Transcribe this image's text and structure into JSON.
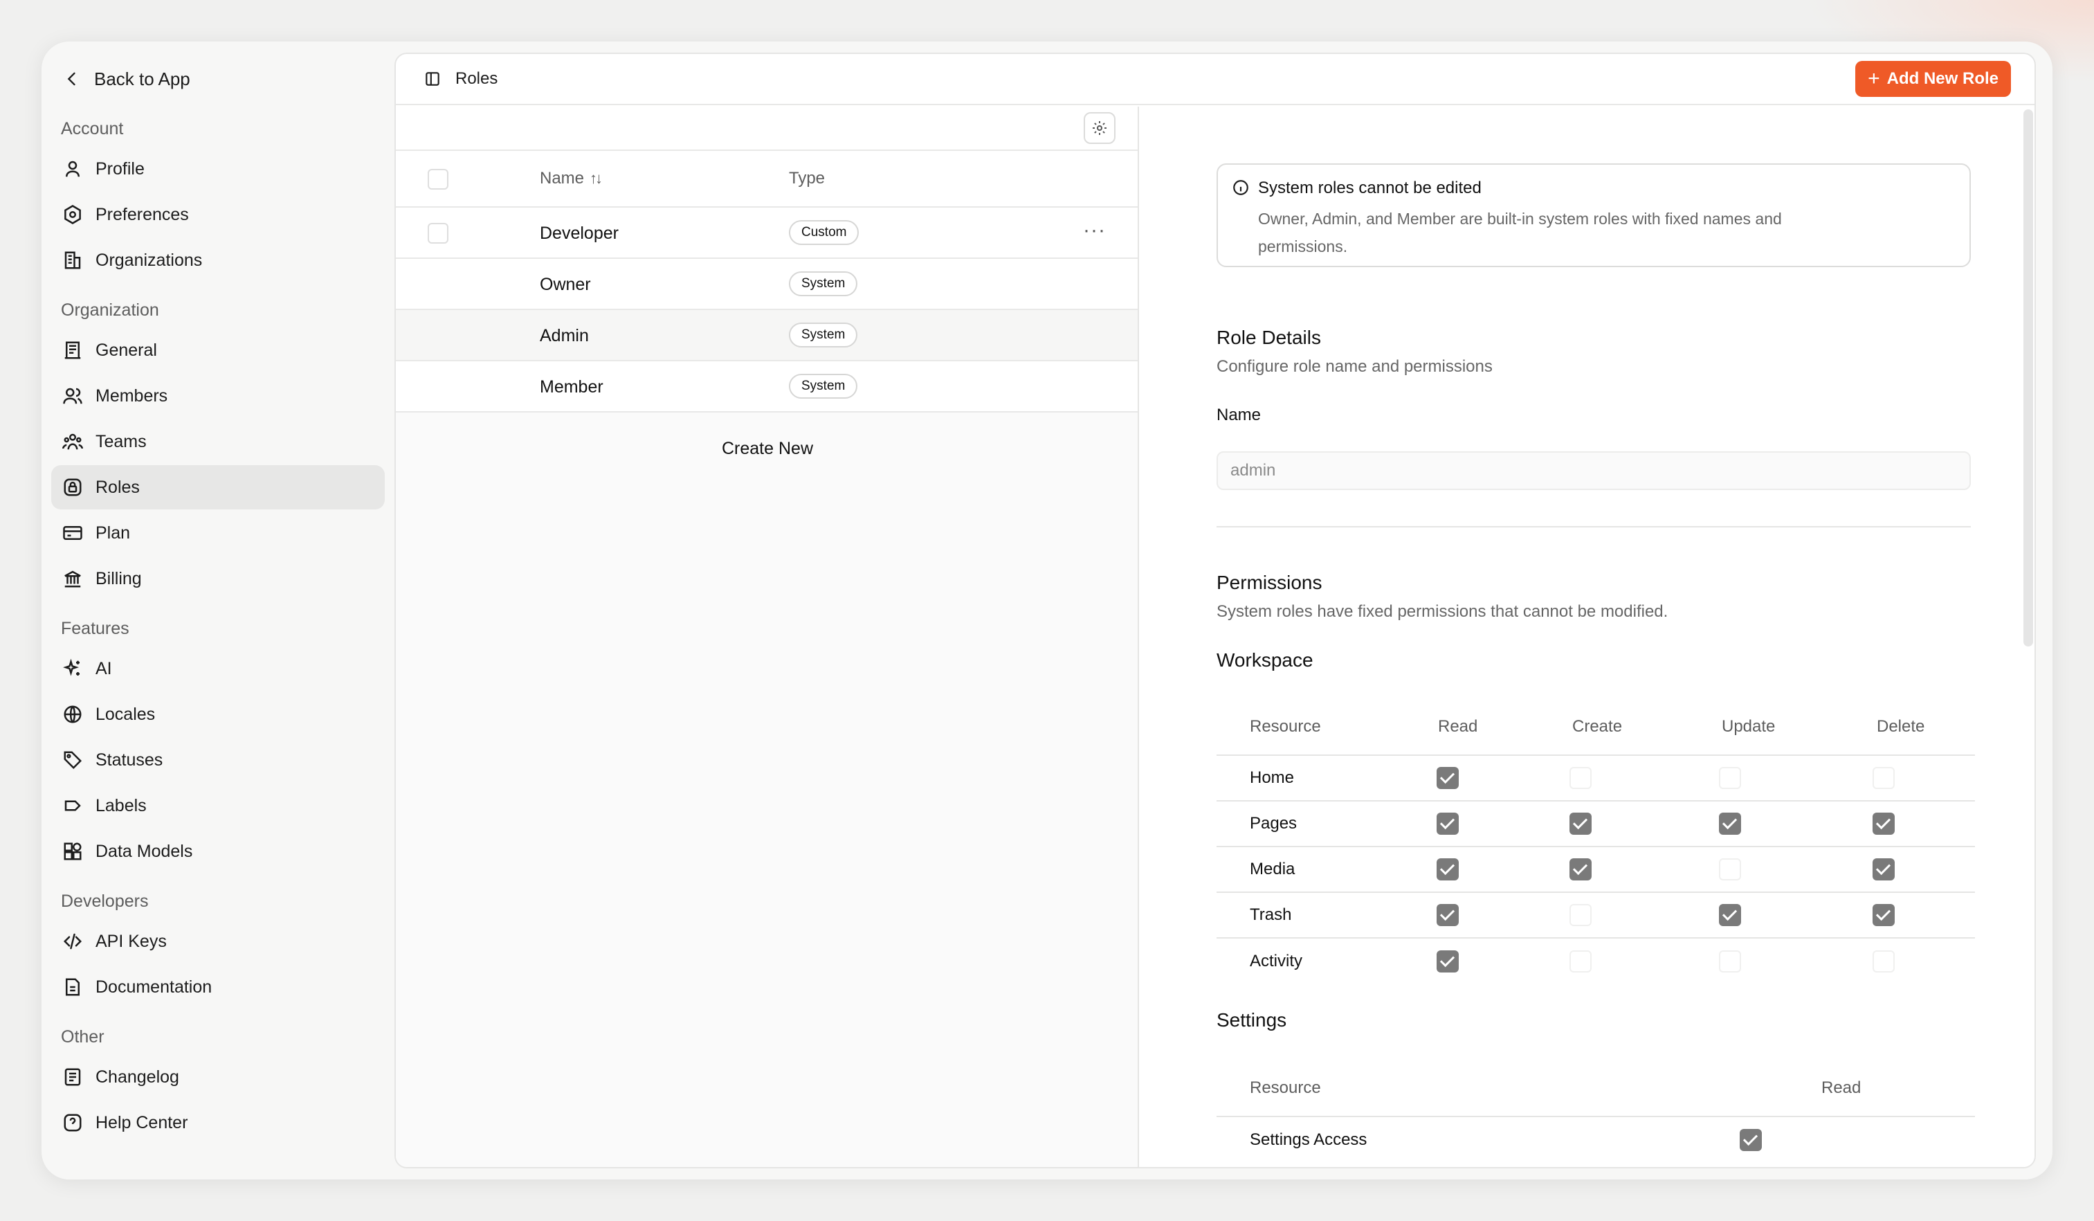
{
  "sidebar": {
    "back_label": "Back to App",
    "groups": [
      {
        "label": "Account",
        "items": [
          {
            "label": "Profile",
            "icon": "user-icon"
          },
          {
            "label": "Preferences",
            "icon": "preferences-icon"
          },
          {
            "label": "Organizations",
            "icon": "building-icon"
          }
        ]
      },
      {
        "label": "Organization",
        "items": [
          {
            "label": "General",
            "icon": "general-icon"
          },
          {
            "label": "Members",
            "icon": "members-icon"
          },
          {
            "label": "Teams",
            "icon": "teams-icon"
          },
          {
            "label": "Roles",
            "icon": "lock-icon",
            "active": true
          },
          {
            "label": "Plan",
            "icon": "card-icon"
          },
          {
            "label": "Billing",
            "icon": "bank-icon"
          }
        ]
      },
      {
        "label": "Features",
        "items": [
          {
            "label": "AI",
            "icon": "sparkles-icon"
          },
          {
            "label": "Locales",
            "icon": "globe-icon"
          },
          {
            "label": "Statuses",
            "icon": "tag-icon"
          },
          {
            "label": "Labels",
            "icon": "label-icon"
          },
          {
            "label": "Data Models",
            "icon": "shapes-icon"
          }
        ]
      },
      {
        "label": "Developers",
        "items": [
          {
            "label": "API Keys",
            "icon": "code-icon"
          },
          {
            "label": "Documentation",
            "icon": "document-icon"
          }
        ]
      },
      {
        "label": "Other",
        "items": [
          {
            "label": "Changelog",
            "icon": "changelog-icon"
          },
          {
            "label": "Help Center",
            "icon": "help-icon"
          }
        ]
      }
    ]
  },
  "header": {
    "title": "Roles",
    "add_button": "Add New Role"
  },
  "roles_table": {
    "columns": {
      "name": "Name",
      "type": "Type"
    },
    "rows": [
      {
        "name": "Developer",
        "type": "Custom"
      },
      {
        "name": "Owner",
        "type": "System"
      },
      {
        "name": "Admin",
        "type": "System"
      },
      {
        "name": "Member",
        "type": "System"
      }
    ],
    "create_new": "Create New"
  },
  "details": {
    "notice": {
      "title": "System roles cannot be edited",
      "text": "Owner, Admin, and Member are built-in system roles with fixed names and permissions."
    },
    "role_details": {
      "title": "Role Details",
      "subtitle": "Configure role name and permissions",
      "name_label": "Name",
      "name_value": "admin"
    },
    "permissions": {
      "title": "Permissions",
      "subtitle": "System roles have fixed permissions that cannot be modified.",
      "workspace": {
        "title": "Workspace",
        "columns": [
          "Resource",
          "Read",
          "Create",
          "Update",
          "Delete"
        ],
        "rows": [
          {
            "resource": "Home",
            "read": true,
            "create": false,
            "update": false,
            "delete": false
          },
          {
            "resource": "Pages",
            "read": true,
            "create": true,
            "update": true,
            "delete": true
          },
          {
            "resource": "Media",
            "read": true,
            "create": true,
            "update": false,
            "delete": true
          },
          {
            "resource": "Trash",
            "read": true,
            "create": false,
            "update": true,
            "delete": true
          },
          {
            "resource": "Activity",
            "read": true,
            "create": false,
            "update": false,
            "delete": false
          }
        ]
      },
      "settings": {
        "title": "Settings",
        "columns": [
          "Resource",
          "Read"
        ],
        "rows": [
          {
            "resource": "Settings Access",
            "read": true
          }
        ]
      }
    }
  },
  "colors": {
    "accent": "#ef5a27",
    "checked": "#7a7a7a"
  }
}
